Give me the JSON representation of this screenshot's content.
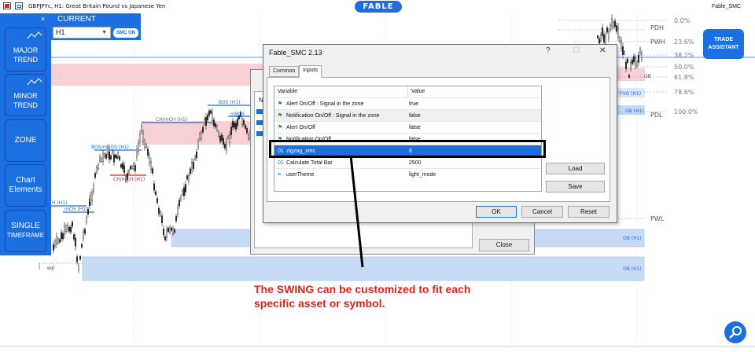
{
  "window": {
    "title": "GBPJPYc, H1:  Great Britain Pound vs Japanese Yen",
    "brand": "FABLE",
    "indicator_name": "Fable_SMC"
  },
  "left_panel": {
    "buttons": [
      {
        "line1": "MAJOR",
        "line2": "TREND"
      },
      {
        "line1": "MINOR",
        "line2": "TREND"
      },
      {
        "line1": "ZONE",
        "line2": ""
      },
      {
        "line1": "Chart",
        "line2": "Elements"
      },
      {
        "line1": "SINGLE",
        "line2": "TIMEFRAME"
      }
    ],
    "close": "×"
  },
  "current_panel": {
    "label": "CURRENT",
    "timeframe": "H1",
    "smc_button": "SMC ON"
  },
  "trade_assistant": {
    "line1": "TRADE",
    "line2": "ASSISTANT"
  },
  "fib_levels": [
    "0.0%",
    "23.6%",
    "38.2%",
    "50.0%",
    "61.8%",
    "78.6%",
    "100.0%"
  ],
  "level_labels": {
    "pdh": "PDH",
    "pwh": "PWH",
    "pdl": "PDL",
    "pwl": "PWL"
  },
  "chart_labels": {
    "bos_h1_top": "BOS (H1)",
    "chmch_h1": "CH/mCH (H1)",
    "mbos": "mBOS",
    "bos_mbos": "BOS/mBOS (H1)",
    "chmch_h1_red": "CH/mCH (H1)",
    "h_h1": "H (H1)",
    "mch_h1": "mCH (H1)",
    "eql": "eql",
    "ob_right": "OB",
    "fvg_h1": "FVG (H1)",
    "ob_h1_small": "OB (H1)",
    "ob_h1_zone1": "OB (H1)",
    "ob_h1_zone2": "OB (H1)"
  },
  "back_dialog": {
    "na": "Na",
    "close_button": "Close"
  },
  "dialog": {
    "title": "Fable_SMC 2.13",
    "tabs": [
      "Common",
      "Inputs"
    ],
    "active_tab": "Inputs",
    "columns": [
      "Variable",
      "Value"
    ],
    "rows": [
      {
        "name": "Alert On/Off : Signal in the zone",
        "value": "true",
        "icon": "flag"
      },
      {
        "name": "Notification On/Off : Signal in the zone",
        "value": "false",
        "icon": "flag"
      },
      {
        "name": "Alert On/Off",
        "value": "false",
        "icon": "flag"
      },
      {
        "name": "Notification On/Off",
        "value": "false",
        "icon": "flag"
      },
      {
        "name": "zigzag_smc",
        "value": "6",
        "icon": "int"
      },
      {
        "name": "Calculate Total Bar",
        "value": "2500",
        "icon": "int"
      },
      {
        "name": "userTheme",
        "value": "light_mode",
        "icon": "enum"
      }
    ],
    "selected_row": 4,
    "load_button": "Load",
    "save_button": "Save",
    "ok_button": "OK",
    "cancel_button": "Cancel",
    "reset_button": "Reset"
  },
  "annotation": {
    "line1": "The SWING can be customized to fit each",
    "line2": "specific asset or symbol."
  },
  "colors": {
    "accent": "#1b6fe0",
    "annotation": "#e0221b",
    "zone_red": "#f9d0d4",
    "zone_blue": "#c7dbf7"
  }
}
